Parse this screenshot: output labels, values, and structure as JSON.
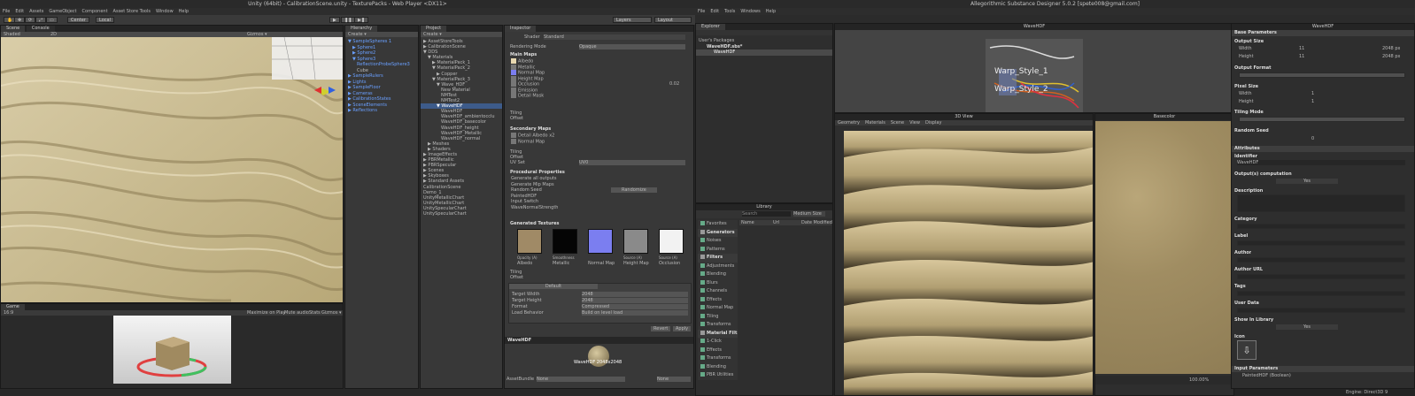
{
  "unity": {
    "title": "Unity (64bit) - CalibrationScene.unity - TexturePacks - Web Player <DX11>",
    "menu": [
      "File",
      "Edit",
      "Assets",
      "GameObject",
      "Component",
      "Asset Store Tools",
      "Window",
      "Help"
    ],
    "toolbar": {
      "center": "Center",
      "local": "Local",
      "layers": "Layers",
      "layout": "Layout"
    },
    "scene": {
      "tab": "Scene",
      "tab2": "Console",
      "shaded": "Shaded",
      "twod": "2D",
      "gizmos": "Gizmos ▾"
    },
    "game": {
      "tab": "Game",
      "aspect": "16:9",
      "buttons": [
        "Maximize on Play",
        "Mute audio",
        "Stats",
        "Gizmos ▾"
      ]
    },
    "hierarchy": {
      "tab": "Hierarchy",
      "create": "Create ▾",
      "items": [
        {
          "label": "▼ SampleSpheres 1",
          "cls": "blue",
          "indent": 0
        },
        {
          "label": "▶ Sphere1",
          "cls": "blue",
          "indent": 1
        },
        {
          "label": "▶ Sphere2",
          "cls": "blue",
          "indent": 1
        },
        {
          "label": "▼ Sphere3",
          "cls": "blue",
          "indent": 1
        },
        {
          "label": "ReflectionProbeSphere3",
          "cls": "blue",
          "indent": 2
        },
        {
          "label": "Cube",
          "cls": "",
          "indent": 2
        },
        {
          "label": "▶ SampleRulers",
          "cls": "blue",
          "indent": 0
        },
        {
          "label": "▶ Lights",
          "cls": "blue",
          "indent": 0
        },
        {
          "label": "▶ SampleFloor",
          "cls": "blue",
          "indent": 0
        },
        {
          "label": "▶ Cameras",
          "cls": "blue",
          "indent": 0
        },
        {
          "label": "▶ CalibrationStates",
          "cls": "blue",
          "indent": 0
        },
        {
          "label": "▶ SceneElements",
          "cls": "blue",
          "indent": 0
        },
        {
          "label": "▶ Reflections",
          "cls": "blue",
          "indent": 0
        }
      ]
    },
    "project": {
      "tab": "Project",
      "create": "Create ▾",
      "items": [
        {
          "label": "▶ AssetStoreTools",
          "indent": 0
        },
        {
          "label": "▶ CalibrationScene",
          "indent": 0
        },
        {
          "label": "▼ DDS",
          "indent": 0
        },
        {
          "label": "▼ Materials",
          "indent": 1
        },
        {
          "label": "▶ MaterialPack_1",
          "indent": 2
        },
        {
          "label": "▼ MaterialPack_2",
          "indent": 2
        },
        {
          "label": "▶ Copper",
          "indent": 3
        },
        {
          "label": "▼ MaterialPack_3",
          "indent": 2
        },
        {
          "label": "▼ Wave_HDF",
          "indent": 3
        },
        {
          "label": "New Material",
          "indent": 4
        },
        {
          "label": "NMTest",
          "indent": 4
        },
        {
          "label": "NMTest2",
          "indent": 4
        },
        {
          "label": "▼ WaveHDF",
          "indent": 3,
          "sel": true
        },
        {
          "label": "WaveHDF",
          "indent": 4
        },
        {
          "label": "WaveHDF_ambientocclu",
          "indent": 4
        },
        {
          "label": "WaveHDF_basecolor",
          "indent": 4
        },
        {
          "label": "WaveHDF_height",
          "indent": 4
        },
        {
          "label": "WaveHDF_Metallic",
          "indent": 4
        },
        {
          "label": "WaveHDF_normal",
          "indent": 4
        },
        {
          "label": "▶ Meshes",
          "indent": 1
        },
        {
          "label": "▶ Shaders",
          "indent": 1
        },
        {
          "label": "▶ ImageEffects",
          "indent": 0
        },
        {
          "label": "▶ PBRMetallic",
          "indent": 0
        },
        {
          "label": "▶ PBRSpecular",
          "indent": 0
        },
        {
          "label": "▶ Scenes",
          "indent": 0
        },
        {
          "label": "▶ Skyboxes",
          "indent": 0
        },
        {
          "label": "▶ Standard Assets",
          "indent": 0
        },
        {
          "label": "CalibrationScene",
          "indent": 0
        },
        {
          "label": "Demo_1",
          "indent": 0
        },
        {
          "label": "UnityMetallicChart",
          "indent": 0
        },
        {
          "label": "UnityMetallicChart",
          "indent": 0
        },
        {
          "label": "UnitySpecularChart",
          "indent": 0
        },
        {
          "label": "UnitySpecularChart",
          "indent": 0
        }
      ]
    },
    "inspector": {
      "tab": "Inspector",
      "shader_label": "Shader",
      "shader": "Standard",
      "rendering_mode": "Rendering Mode",
      "rendering_value": "Opaque",
      "main_maps": "Main Maps",
      "maps": [
        "Albedo",
        "Metallic",
        "Normal Map",
        "Height Map",
        "Occlusion",
        "Emission",
        "Detail Mask"
      ],
      "height_value": "0.02",
      "tiling": "Tiling",
      "offset": "Offset",
      "secondary": "Secondary Maps",
      "sec_maps": [
        "Detail Albedo x2",
        "Normal Map"
      ],
      "uv_set": "UV Set",
      "uv_value": "UV0",
      "procedural": "Procedural Properties",
      "proc_rows": [
        "Generate all outputs",
        "Generate Mip Maps",
        "Random Seed",
        "PaintedHDF",
        "Input Switch",
        "WaveNormalStrength"
      ],
      "randomize": "Randomize",
      "generated": "Generated Textures",
      "textures": [
        {
          "name": "Albedo",
          "sub": "Opacity (A)",
          "color": "#a08a66"
        },
        {
          "name": "Metallic",
          "sub": "Smoothness",
          "color": "#050505"
        },
        {
          "name": "Normal Map",
          "sub": "",
          "color": "#7b7ef0"
        },
        {
          "name": "Height Map",
          "sub": "Source (A)",
          "color": "#8a8a8a"
        },
        {
          "name": "Occlusion",
          "sub": "Source (A)",
          "color": "#f2f2f2"
        }
      ],
      "default": "Default",
      "target_width": "Target Width",
      "tw_value": "2048",
      "target_height": "Target Height",
      "th_value": "2048",
      "format": "Format",
      "format_value": "Compressed",
      "load": "Load Behavior",
      "load_value": "Build on level load",
      "revert": "Revert",
      "apply": "Apply",
      "preview_name": "WaveHDF",
      "preview_label": "WaveHDF   2048x2048",
      "assetbundle": "AssetBundle",
      "none": "None"
    }
  },
  "sd": {
    "title": "Allegorithmic Substance Designer 5.0.2 [spete008@gmail.com]",
    "menu": [
      "File",
      "Edit",
      "Tools",
      "Windows",
      "Help"
    ],
    "explorer": {
      "tab": "Explorer",
      "packages": "User's Packages",
      "pkg": "WaveHDF.sbs*",
      "graph": "WaveHDF"
    },
    "graph": {
      "tab": "WaveHDF",
      "node1": "Warp_Style_1",
      "node2": "Warp_Style_2"
    },
    "view3d": {
      "tab": "3D View",
      "menu": [
        "Geometry",
        "Materials",
        "Scene",
        "View",
        "Display"
      ]
    },
    "view2d": {
      "tab": "Basecolor"
    },
    "library": {
      "tab": "Library",
      "search": "Search",
      "size": "Medium Size",
      "cols": [
        "Name",
        "Url",
        "Date Modified"
      ],
      "items": [
        {
          "label": "Favorites",
          "hdr": false
        },
        {
          "label": "Generators",
          "hdr": true
        },
        {
          "label": "Noises",
          "hdr": false
        },
        {
          "label": "Patterns",
          "hdr": false
        },
        {
          "label": "Filters",
          "hdr": true
        },
        {
          "label": "Adjustments",
          "hdr": false
        },
        {
          "label": "Blending",
          "hdr": false
        },
        {
          "label": "Blurs",
          "hdr": false
        },
        {
          "label": "Channels",
          "hdr": false
        },
        {
          "label": "Effects",
          "hdr": false
        },
        {
          "label": "Normal Map",
          "hdr": false
        },
        {
          "label": "Tiling",
          "hdr": false
        },
        {
          "label": "Transforms",
          "hdr": false
        },
        {
          "label": "Material Filt...",
          "hdr": true
        },
        {
          "label": "1-Click",
          "hdr": false
        },
        {
          "label": "Effects",
          "hdr": false
        },
        {
          "label": "Transforms",
          "hdr": false
        },
        {
          "label": "Blending",
          "hdr": false
        },
        {
          "label": "PBR Utilities",
          "hdr": false
        }
      ]
    },
    "params": {
      "tab": "WaveHDF",
      "base": "Base Parameters",
      "output_size": "Output Size",
      "width": "Width",
      "height": "Height",
      "wval": "11",
      "hval": "11",
      "wpx": "2048 px",
      "hpx": "2048 px",
      "output_format": "Output Format",
      "pixel_size": "Pixel Size",
      "pwidth": "1",
      "pheight": "1",
      "tiling_mode": "Tiling Mode",
      "random_seed": "Random Seed",
      "seed_val": "0",
      "attributes": "Attributes",
      "identifier": "Identifier",
      "id_val": "WaveHDF",
      "outputs_comp": "Output(s) computation",
      "yes": "Yes",
      "description": "Description",
      "category": "Category",
      "label": "Label",
      "author": "Author",
      "author_url": "Author URL",
      "tags": "Tags",
      "user_data": "User Data",
      "show_lib": "Show In Library",
      "icon": "Icon",
      "input_params": "Input Parameters",
      "painted": "PaintedHDF (Boolean)"
    },
    "status": "Engine: Direct3D 9",
    "zoom": "100.00%"
  }
}
